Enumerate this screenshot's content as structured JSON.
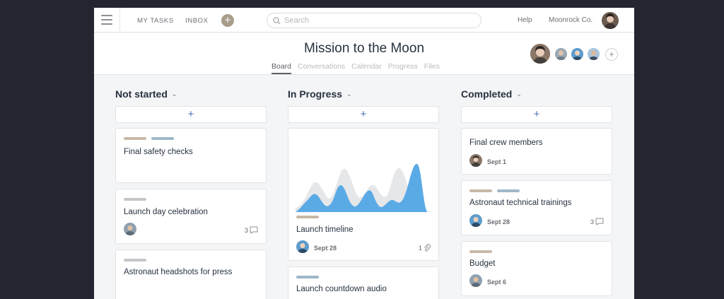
{
  "topbar": {
    "nav": [
      "MY TASKS",
      "INBOX"
    ],
    "add_label": "+",
    "search_placeholder": "Search",
    "help": "Help",
    "org": "Moonrock Co."
  },
  "project": {
    "title": "Mission to the Moon",
    "tabs": [
      {
        "label": "Board",
        "active": true
      },
      {
        "label": "Conversations",
        "active": false
      },
      {
        "label": "Calendar",
        "active": false
      },
      {
        "label": "Progress",
        "active": false
      },
      {
        "label": "Files",
        "active": false
      }
    ],
    "add_member": "+"
  },
  "colors": {
    "accent_blue": "#4a90e2",
    "tag_tan": "#c8b8a6",
    "tag_blue": "#9fb8c9",
    "tag_gray": "#c4c6c9",
    "chart_blue": "#5aaae6",
    "chart_gray": "#e6e7e9"
  },
  "columns": [
    {
      "title": "Not started",
      "add": "+",
      "cards": [
        {
          "title": "Final safety checks"
        },
        {
          "title": "Launch day celebration",
          "comments": "3"
        },
        {
          "title": "Astronaut headshots for press"
        }
      ]
    },
    {
      "title": "In Progress",
      "add": "+",
      "cards": [
        {
          "title": "Launch timeline",
          "date": "Sept 28",
          "attachments": "1"
        },
        {
          "title": "Launch countdown audio"
        }
      ]
    },
    {
      "title": "Completed",
      "add": "+",
      "cards": [
        {
          "title": "Final crew members",
          "date": "Sept 1"
        },
        {
          "title": "Astronaut technical trainings",
          "date": "Sept 28",
          "comments": "3"
        },
        {
          "title": "Budget",
          "date": "Sept 6"
        }
      ]
    }
  ]
}
